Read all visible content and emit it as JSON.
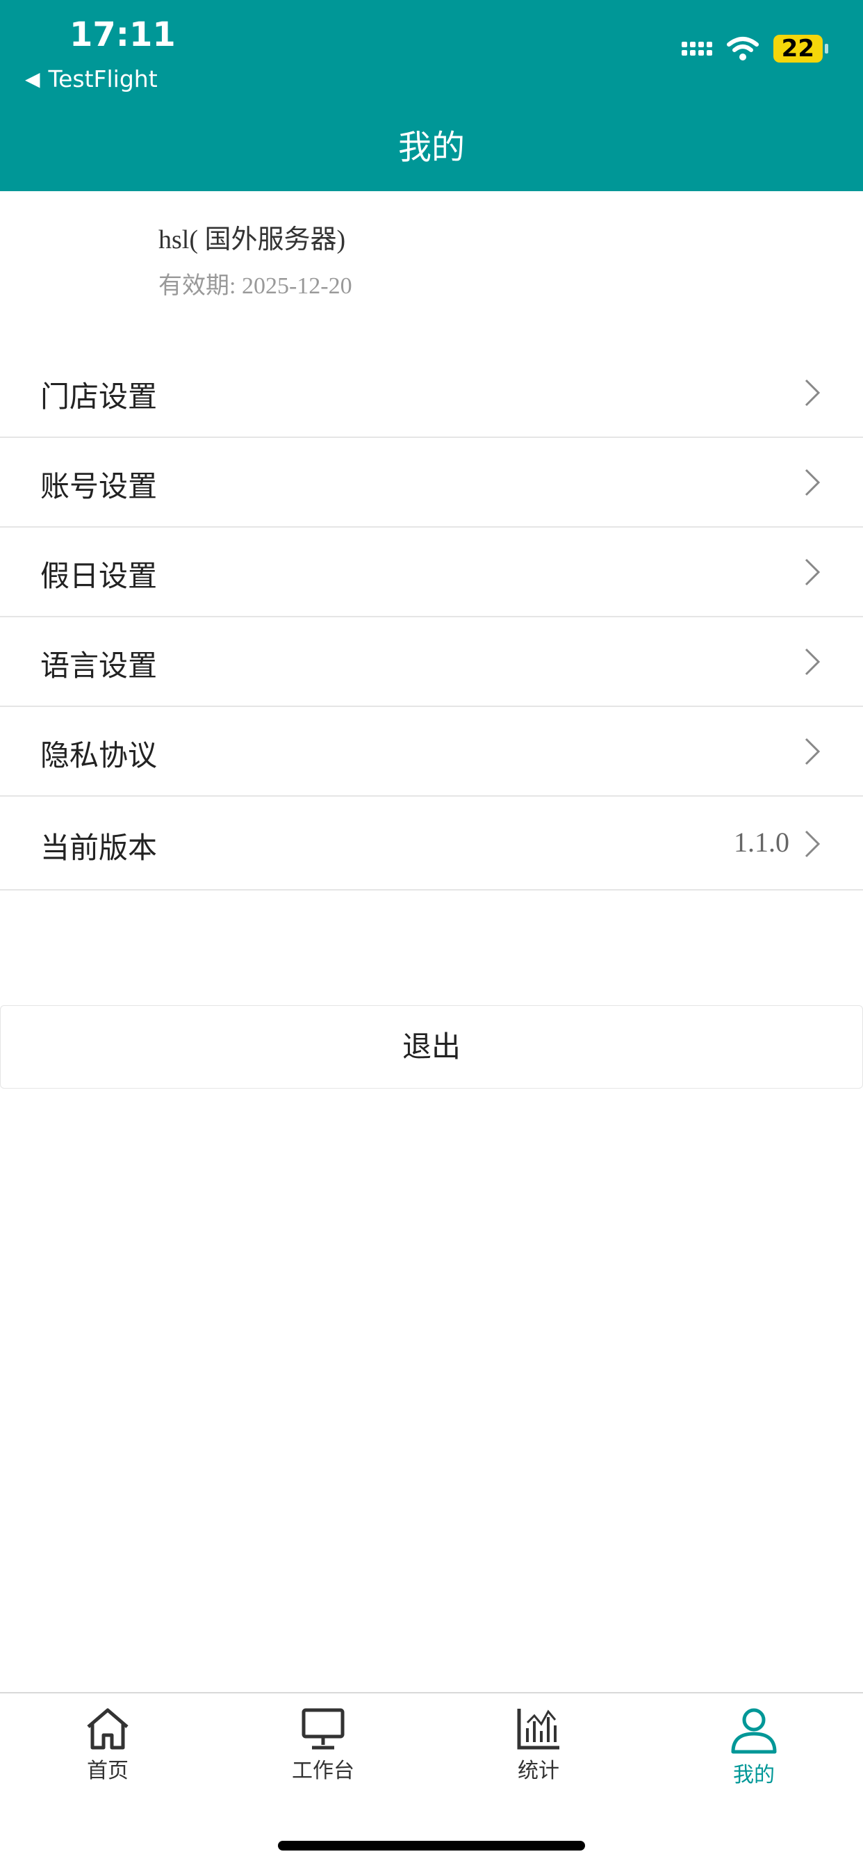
{
  "status_bar": {
    "time": "17:11",
    "back_app": "TestFlight",
    "battery": "22"
  },
  "header": {
    "title": "我的"
  },
  "profile": {
    "name": "hsl( 国外服务器)",
    "expiry": "有效期: 2025-12-20"
  },
  "menu": {
    "items": [
      {
        "label": "门店设置",
        "value": ""
      },
      {
        "label": "账号设置",
        "value": ""
      },
      {
        "label": "假日设置",
        "value": ""
      },
      {
        "label": "语言设置",
        "value": ""
      },
      {
        "label": "隐私协议",
        "value": ""
      },
      {
        "label": "当前版本",
        "value": "1.1.0"
      }
    ]
  },
  "logout_label": "退出",
  "tabbar": {
    "tabs": [
      {
        "label": "首页",
        "icon": "home-icon"
      },
      {
        "label": "工作台",
        "icon": "monitor-icon"
      },
      {
        "label": "统计",
        "icon": "chart-icon"
      },
      {
        "label": "我的",
        "icon": "user-icon",
        "active": true
      }
    ]
  },
  "colors": {
    "primary": "#009797",
    "battery": "#f5d60a"
  }
}
